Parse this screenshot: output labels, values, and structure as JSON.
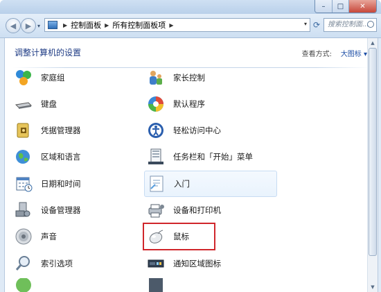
{
  "window": {
    "controls": {
      "minimize": "–",
      "maximize": "□",
      "close": "✕"
    }
  },
  "navbar": {
    "back_glyph": "◀",
    "forward_glyph": "▶",
    "dropdown_glyph": "▾",
    "breadcrumb": [
      "控制面板",
      "所有控制面板项"
    ],
    "breadcrumb_sep": "▶",
    "address_dropdown_glyph": "▾",
    "refresh_glyph": "⟳",
    "search_placeholder": "搜索控制面..."
  },
  "content": {
    "heading": "调整计算机的设置",
    "view_by_label": "查看方式:",
    "view_by_value": "大图标 ▾",
    "highlighted_item": "鼠标",
    "hovered_item": "入门",
    "items_left": [
      {
        "label": "家庭组",
        "icon": "homegroup-icon"
      },
      {
        "label": "键盘",
        "icon": "keyboard-icon"
      },
      {
        "label": "凭据管理器",
        "icon": "credential-manager-icon"
      },
      {
        "label": "区域和语言",
        "icon": "region-language-icon"
      },
      {
        "label": "日期和时间",
        "icon": "date-time-icon"
      },
      {
        "label": "设备管理器",
        "icon": "device-manager-icon"
      },
      {
        "label": "声音",
        "icon": "sound-icon"
      },
      {
        "label": "索引选项",
        "icon": "indexing-options-icon"
      }
    ],
    "items_right": [
      {
        "label": "家长控制",
        "icon": "parental-controls-icon"
      },
      {
        "label": "默认程序",
        "icon": "default-programs-icon"
      },
      {
        "label": "轻松访问中心",
        "icon": "ease-of-access-icon"
      },
      {
        "label": "任务栏和「开始」菜单",
        "icon": "taskbar-start-menu-icon"
      },
      {
        "label": "入门",
        "icon": "getting-started-icon"
      },
      {
        "label": "设备和打印机",
        "icon": "devices-printers-icon"
      },
      {
        "label": "鼠标",
        "icon": "mouse-icon"
      },
      {
        "label": "通知区域图标",
        "icon": "notification-area-icon"
      }
    ]
  },
  "colors": {
    "accent_heading": "#1e3b84",
    "highlight_border": "#d0262b"
  }
}
